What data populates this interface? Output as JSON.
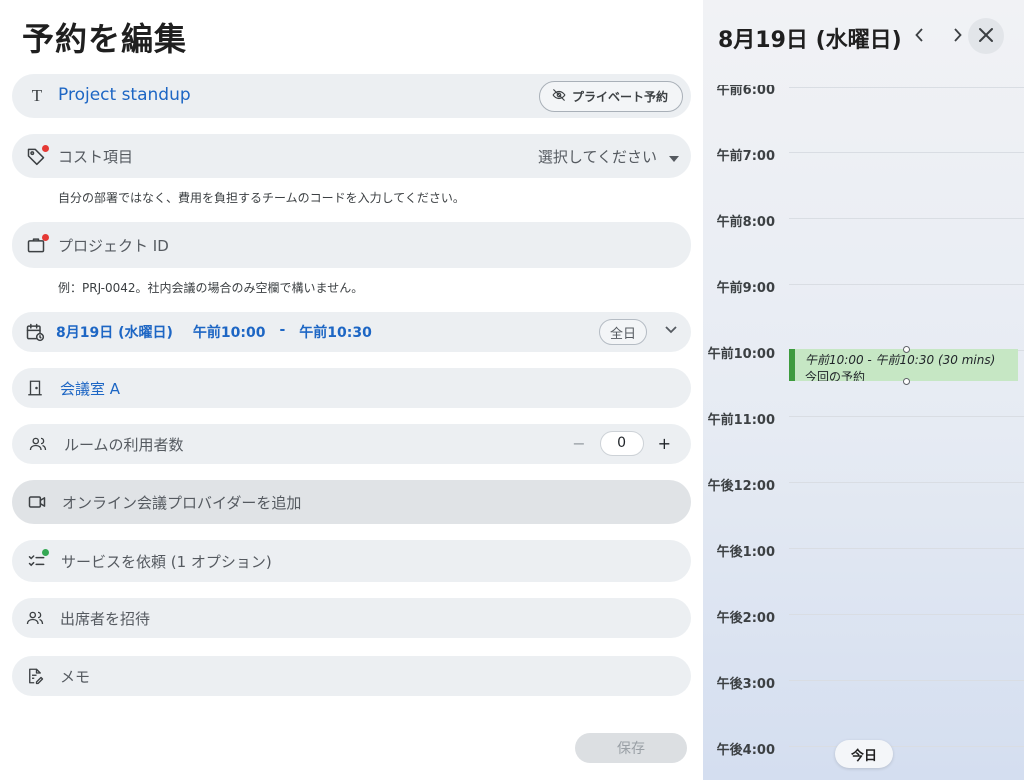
{
  "form": {
    "title": "予約を編集",
    "meeting_title": "Project standup",
    "private_button": "プライベート予約",
    "cost": {
      "label": "コスト項目",
      "select_value": "選択してください",
      "hint": "自分の部署ではなく、費用を負担するチームのコードを入力してください。"
    },
    "project": {
      "label": "プロジェクト ID",
      "hint": "例：PRJ-0042。社内会議の場合のみ空欄で構いません。"
    },
    "datetime": {
      "date": "8月19日 (水曜日)",
      "start": "午前10:00",
      "separator": "-",
      "end": "午前10:30",
      "all_day": "全日"
    },
    "room": "会議室 A",
    "people": {
      "label": "ルームの利用者数",
      "count": "0",
      "minus": "−",
      "plus": "+"
    },
    "online": "オンライン会議プロバイダーを追加",
    "service": "サービスを依頼 (1 オプション)",
    "invite": "出席者を招待",
    "memo": "メモ",
    "save": "保存"
  },
  "calendar": {
    "date": "8月19日 (水曜日)",
    "hours": [
      "午前6:00",
      "午前7:00",
      "午前8:00",
      "午前9:00",
      "午前10:00",
      "午前11:00",
      "午後12:00",
      "午後1:00",
      "午後2:00",
      "午後3:00",
      "午後4:00"
    ],
    "event": {
      "time": "午前10:00 - 午前10:30 (30 mins)",
      "name": "今回の予約"
    },
    "today": "今日"
  },
  "colors": {
    "accent_text": "#1d66c4",
    "required_dot": "#e53935",
    "service_dot": "#34a853",
    "event_fill": "#c6e7c4",
    "event_border": "#3d9b3d"
  },
  "icons": {
    "title": "title-t-icon",
    "private": "eye-off-icon",
    "cost": "tag-icon",
    "project": "briefcase-icon",
    "date": "calendar-clock-icon",
    "room": "door-icon",
    "people": "people-icon",
    "online": "video-icon",
    "service": "checklist-icon",
    "invite": "person-add-icon",
    "memo": "note-edit-icon"
  }
}
